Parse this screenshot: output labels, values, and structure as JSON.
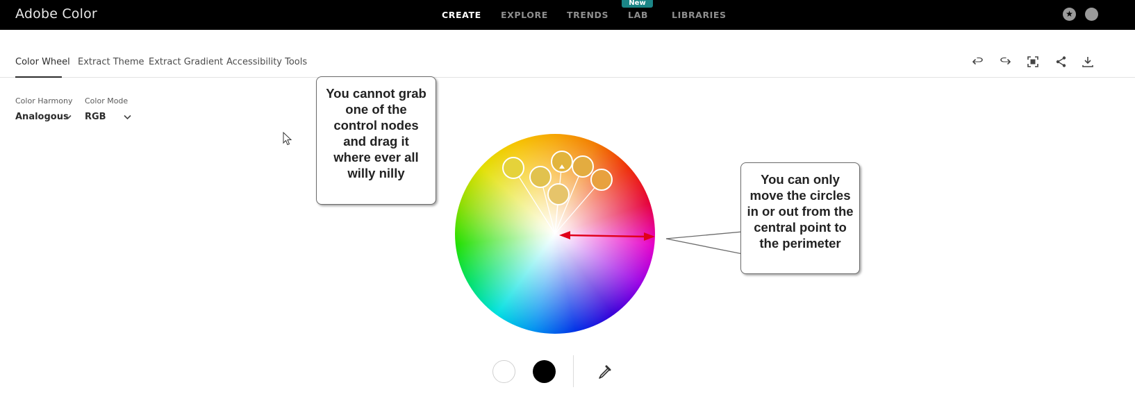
{
  "app": {
    "title": "Adobe Color"
  },
  "topnav": {
    "items": [
      {
        "label": "CREATE",
        "active": true
      },
      {
        "label": "EXPLORE",
        "active": false
      },
      {
        "label": "TRENDS",
        "active": false
      },
      {
        "label": "LAB",
        "active": false
      },
      {
        "label": "LIBRARIES",
        "active": false
      }
    ],
    "badge": "New"
  },
  "subtabs": {
    "items": [
      {
        "label": "Color Wheel",
        "active": true
      },
      {
        "label": "Extract Theme",
        "active": false
      },
      {
        "label": "Extract Gradient",
        "active": false
      },
      {
        "label": "Accessibility Tools",
        "active": false
      }
    ]
  },
  "toolbar": {
    "icons": [
      "undo-icon",
      "redo-icon",
      "fullscreen-icon",
      "share-icon",
      "download-icon"
    ]
  },
  "controls": {
    "harmony_label": "Color Harmony",
    "harmony_value": "Analogous",
    "mode_label": "Color Mode",
    "mode_value": "RGB"
  },
  "annotations": {
    "left": "You cannot grab one of the control nodes and drag it where ever all willy nilly",
    "right": "You can only move the circles in or out from the central point to the perimeter"
  },
  "colors": {
    "topbar_bg": "#000000",
    "badge_bg": "#1b8586",
    "arrow": "#e0001a",
    "node_fill": "#e3c04a"
  },
  "swatches": [
    "#ffffff",
    "#000000"
  ]
}
